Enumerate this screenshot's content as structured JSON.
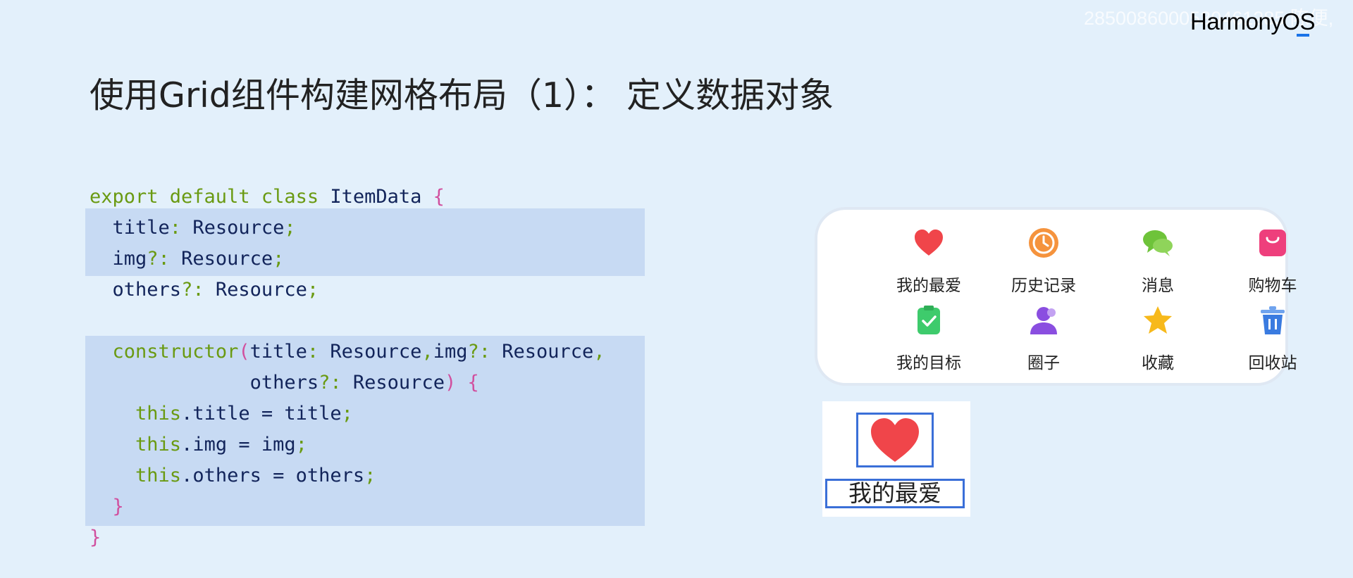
{
  "watermark": "28500860005304612​85 陈便,",
  "brand": {
    "name": "HarmonyOS"
  },
  "title": "使用Grid组件构建网格布局（1）： 定义数据对象",
  "code": {
    "l1": {
      "kw": "export default class",
      "name": " ItemData ",
      "brace": "{"
    },
    "l2": {
      "prop": "title",
      "colon": ": ",
      "type": "Resource",
      "end": ";"
    },
    "l3": {
      "prop": "img",
      "colon": "?: ",
      "type": "Resource",
      "end": ";"
    },
    "l4": {
      "prop": "others",
      "colon": "?: ",
      "type": "Resource",
      "end": ";"
    },
    "l5": {
      "kw": "constructor",
      "paren": "(",
      "p1": "title",
      "c1": ": ",
      "t1": "Resource",
      "comma1": ",",
      "p2": "img",
      "c2": "?: ",
      "t2": "Resource",
      "comma2": ","
    },
    "l6": {
      "p3": "others",
      "c3": "?: ",
      "t3": "Resource",
      "paren": ")",
      "brace": " {"
    },
    "l7": {
      "kw": "this",
      "rest": ".title = title",
      "end": ";"
    },
    "l8": {
      "kw": "this",
      "rest": ".img = img",
      "end": ";"
    },
    "l9": {
      "kw": "this",
      "rest": ".others = others",
      "end": ";"
    },
    "l10": "}",
    "l11": "}"
  },
  "grid": {
    "items": [
      {
        "label": "我的最爱",
        "icon": "heart-icon",
        "color": "#f0454a"
      },
      {
        "label": "历史记录",
        "icon": "clock-icon",
        "color": "#f5933d"
      },
      {
        "label": "消息",
        "icon": "chat-bubble-icon",
        "color": "#6ec33a"
      },
      {
        "label": "购物车",
        "icon": "shopping-bag-icon",
        "color": "#ee3f7c"
      },
      {
        "label": "我的目标",
        "icon": "clipboard-check-icon",
        "color": "#3ecb6c"
      },
      {
        "label": "圈子",
        "icon": "people-icon",
        "color": "#8a4ee0"
      },
      {
        "label": "收藏",
        "icon": "star-icon",
        "color": "#f7b91b"
      },
      {
        "label": "回收站",
        "icon": "trash-icon",
        "color": "#3a7be0"
      }
    ]
  },
  "zoom": {
    "label": "我的最爱",
    "icon": "heart-icon",
    "frame_color": "#3a6fd8"
  }
}
